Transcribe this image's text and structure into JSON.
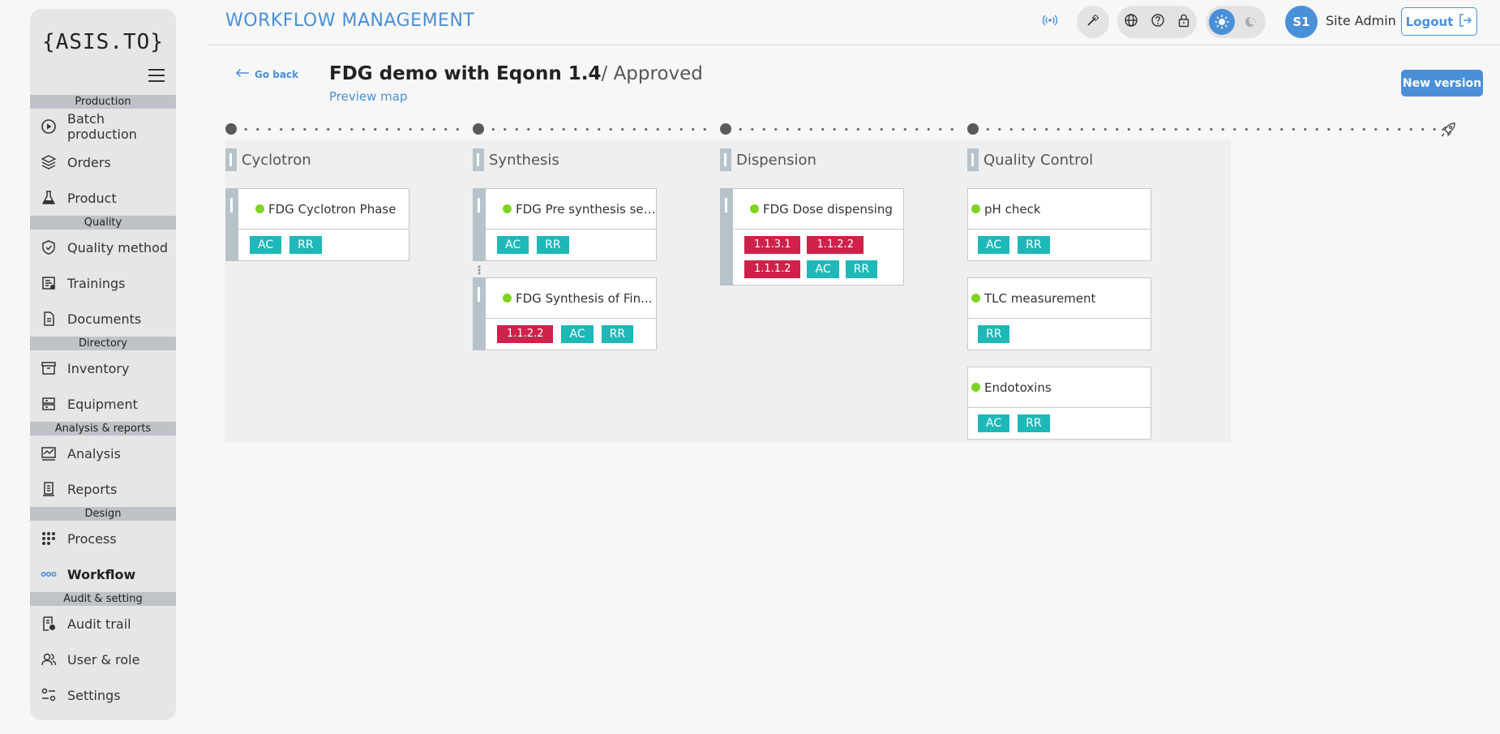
{
  "sidebar": {
    "logo": "{ASIS.TO}",
    "sections": [
      {
        "label": "Production",
        "items": [
          {
            "label": "Batch production",
            "icon": "play-circle-icon"
          },
          {
            "label": "Orders",
            "icon": "layers-icon"
          },
          {
            "label": "Product",
            "icon": "flask-icon"
          }
        ]
      },
      {
        "label": "Quality",
        "items": [
          {
            "label": "Quality method",
            "icon": "shield-check-icon"
          },
          {
            "label": "Trainings",
            "icon": "training-icon"
          },
          {
            "label": "Documents",
            "icon": "document-icon"
          }
        ]
      },
      {
        "label": "Directory",
        "items": [
          {
            "label": "Inventory",
            "icon": "archive-icon"
          },
          {
            "label": "Equipment",
            "icon": "server-icon"
          }
        ]
      },
      {
        "label": "Analysis & reports",
        "items": [
          {
            "label": "Analysis",
            "icon": "chart-icon"
          },
          {
            "label": "Reports",
            "icon": "report-icon"
          }
        ]
      },
      {
        "label": "Design",
        "items": [
          {
            "label": "Process",
            "icon": "grid-dots-icon"
          },
          {
            "label": "Workflow",
            "icon": "workflow-icon",
            "active": true
          }
        ]
      },
      {
        "label": "Audit & setting",
        "items": [
          {
            "label": "Audit trail",
            "icon": "audit-icon"
          },
          {
            "label": "User & role",
            "icon": "users-icon"
          },
          {
            "label": "Settings",
            "icon": "settings-icon"
          }
        ]
      }
    ]
  },
  "header": {
    "title": "WORKFLOW MANAGEMENT",
    "avatar_initials": "S1",
    "user_name": "Site Admin",
    "logout_label": "Logout"
  },
  "page": {
    "go_back_label": "Go back",
    "title": "FDG demo with Eqonn 1.4",
    "status": "/ Approved",
    "preview_map_label": "Preview map",
    "new_version_label": "New version"
  },
  "colors": {
    "accent": "#4a90d9",
    "tag_teal": "#1eb8b8",
    "tag_red": "#cf2149",
    "status_green": "#7ed321"
  },
  "stages": [
    {
      "name": "Cyclotron",
      "cards": [
        {
          "title": "FDG Cyclotron Phase",
          "tags": [
            {
              "text": "AC",
              "color": "teal"
            },
            {
              "text": "RR",
              "color": "teal"
            }
          ]
        }
      ]
    },
    {
      "name": "Synthesis",
      "cards": [
        {
          "title": "FDG Pre synthesis set...",
          "tags": [
            {
              "text": "AC",
              "color": "teal"
            },
            {
              "text": "RR",
              "color": "teal"
            }
          ]
        },
        {
          "title": "FDG Synthesis of Fin...",
          "tags": [
            {
              "text": "1.1.2.2",
              "color": "red"
            },
            {
              "text": "AC",
              "color": "teal"
            },
            {
              "text": "RR",
              "color": "teal"
            }
          ]
        }
      ]
    },
    {
      "name": "Dispension",
      "cards": [
        {
          "title": "FDG Dose dispensing",
          "tags": [
            {
              "text": "1.1.3.1",
              "color": "red"
            },
            {
              "text": "1.1.2.2",
              "color": "red"
            },
            {
              "text": "1.1.1.2",
              "color": "red"
            },
            {
              "text": "AC",
              "color": "teal"
            },
            {
              "text": "RR",
              "color": "teal"
            }
          ]
        }
      ]
    },
    {
      "name": "Quality Control",
      "cards": [
        {
          "title": "pH check",
          "tags": [
            {
              "text": "AC",
              "color": "teal"
            },
            {
              "text": "RR",
              "color": "teal"
            }
          ]
        },
        {
          "title": "TLC measurement",
          "tags": [
            {
              "text": "RR",
              "color": "teal"
            }
          ]
        },
        {
          "title": "Endotoxins",
          "tags": [
            {
              "text": "AC",
              "color": "teal"
            },
            {
              "text": "RR",
              "color": "teal"
            }
          ]
        }
      ]
    }
  ]
}
